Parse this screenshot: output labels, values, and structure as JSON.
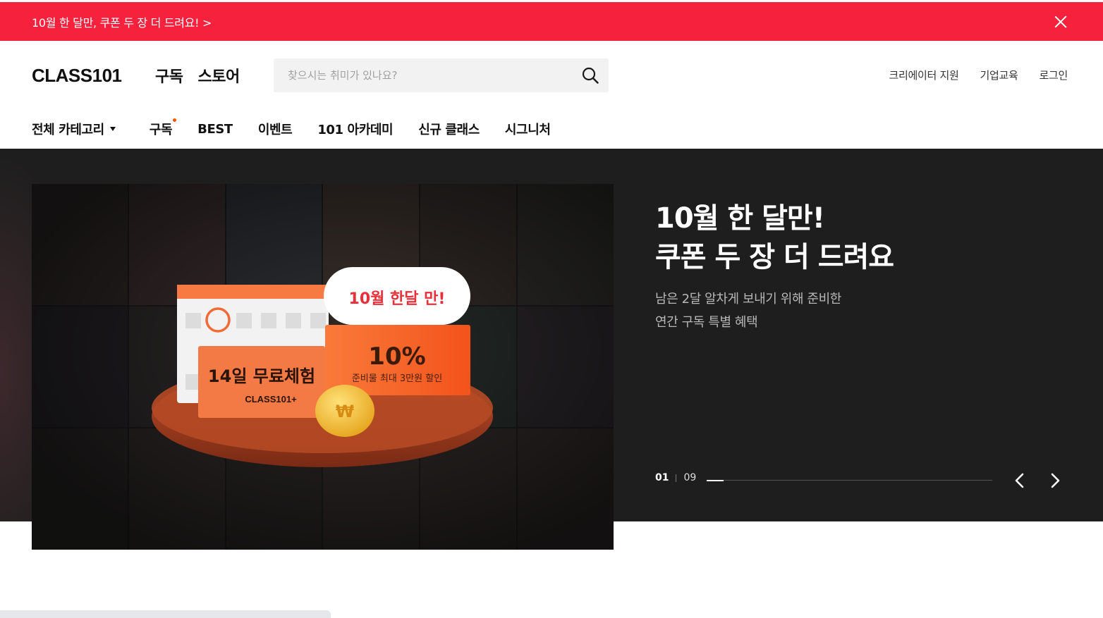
{
  "promo_banner": {
    "text": "10월 한 달만, 쿠폰 두 장 더 드려요! >",
    "close_icon": "close-icon"
  },
  "header": {
    "logo": "CLASS101",
    "main_nav": [
      "구독",
      "스토어"
    ],
    "search": {
      "placeholder": "찾으시는 취미가 있나요?",
      "icon": "search-icon"
    },
    "util_nav": [
      "크리에이터 지원",
      "기업교육",
      "로그인"
    ]
  },
  "category_nav": {
    "all_label": "전체 카테고리",
    "items": [
      {
        "label": "구독",
        "new_dot": true
      },
      {
        "label": "BEST"
      },
      {
        "label": "이벤트"
      },
      {
        "label": "101 아카데미"
      },
      {
        "label": "신규 클래스"
      },
      {
        "label": "시그니처"
      }
    ]
  },
  "hero": {
    "title_line1": "10월 한 달만!",
    "title_line2": "쿠폰 두 장 더 드려요",
    "sub_line1": "남은 2달 알차게 보내기 위해 준비한",
    "sub_line2": "연간 구독 특별 혜택",
    "image": {
      "badge": "10월 한달 만!",
      "ticket1_title": "14일 무료체험",
      "ticket1_brand": "CLASS101+",
      "ticket2_big": "10%",
      "ticket2_sub": "준비물 최대 3만원 할인",
      "coin_symbol": "₩"
    },
    "pager": {
      "current": "01",
      "total": "09",
      "progress": 0.06
    }
  },
  "colors": {
    "brand_red": "#f6223d",
    "accent_orange": "#ff5600",
    "hero_bg": "#1e1e1e"
  }
}
